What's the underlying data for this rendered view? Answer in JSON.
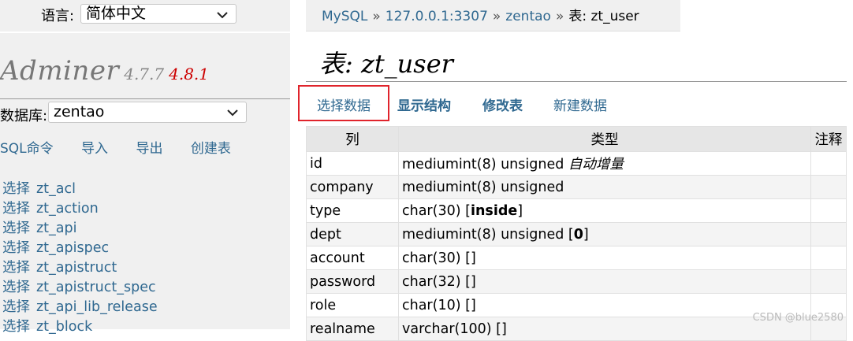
{
  "sidebar": {
    "language_label": "语言:",
    "language_value": "简体中文",
    "logo_name": "Adminer",
    "logo_version": "4.7.7",
    "logo_new_version": "4.8.1",
    "db_label": "数据库:",
    "db_value": "zentao",
    "links": [
      "SQL命令",
      "导入",
      "导出",
      "创建表"
    ],
    "select_prefix": "选择",
    "tables": [
      "zt_acl",
      "zt_action",
      "zt_api",
      "zt_apispec",
      "zt_apistruct",
      "zt_apistruct_spec",
      "zt_api_lib_release",
      "zt_block"
    ]
  },
  "breadcrumb": {
    "items": [
      "MySQL",
      "127.0.0.1:3307",
      "zentao"
    ],
    "separator": "»",
    "current": "表: zt_user"
  },
  "page_title": "表: zt_user",
  "tabs": [
    "选择数据",
    "显示结构",
    "修改表",
    "新建数据"
  ],
  "table": {
    "headers": [
      "列",
      "类型",
      "注释"
    ],
    "rows": [
      {
        "col": "id",
        "type": "mediumint(8) unsigned",
        "extra": "自动增量"
      },
      {
        "col": "company",
        "type": "mediumint(8) unsigned",
        "extra": ""
      },
      {
        "col": "type",
        "type": "char(30) [",
        "default": "inside",
        "close": "]"
      },
      {
        "col": "dept",
        "type": "mediumint(8) unsigned [",
        "default": "0",
        "close": "]"
      },
      {
        "col": "account",
        "type": "char(30) []"
      },
      {
        "col": "password",
        "type": "char(32) []"
      },
      {
        "col": "role",
        "type": "char(10) []"
      },
      {
        "col": "realname",
        "type": "varchar(100) []"
      }
    ]
  },
  "watermark": "CSDN @blue2580",
  "colors": {
    "link": "#2f6890",
    "highlight_border": "#e0242c",
    "version_new": "#cc0000"
  }
}
